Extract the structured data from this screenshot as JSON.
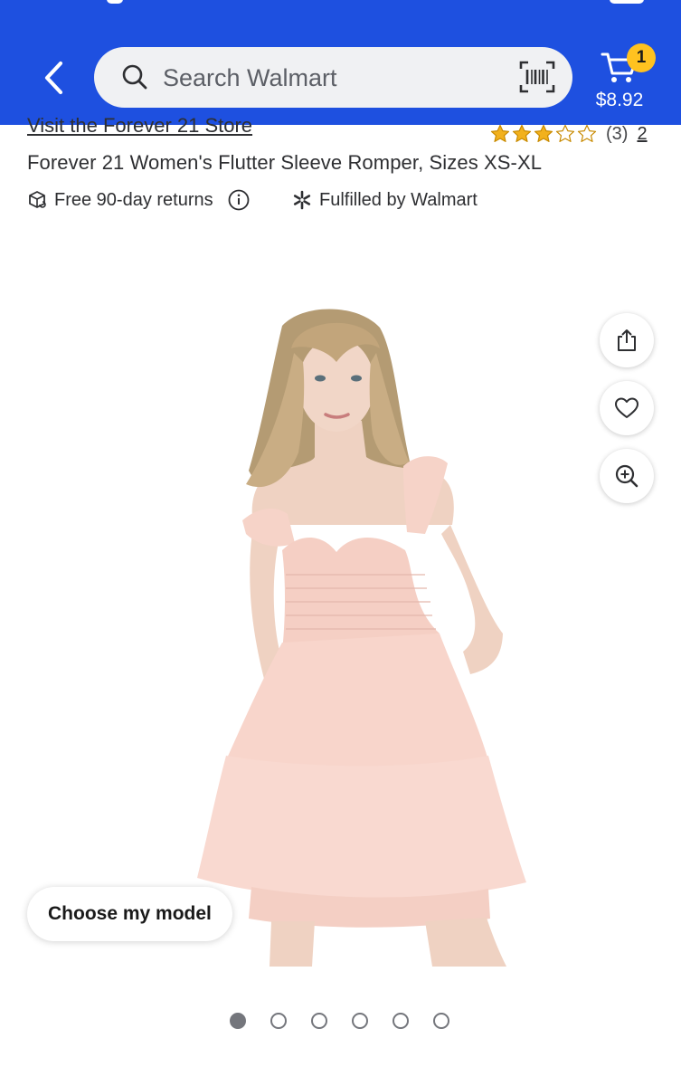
{
  "header": {
    "search": {
      "placeholder": "Search Walmart"
    },
    "cart": {
      "count": "1",
      "total": "$8.92"
    }
  },
  "product": {
    "store_link": "Visit the Forever 21 Store",
    "rating": {
      "stars": 3,
      "max": 5,
      "count_text": "(3)",
      "reviews_link": "2"
    },
    "title": "Forever 21 Women's Flutter Sleeve Romper, Sizes XS-XL",
    "features": [
      {
        "label": "Free 90-day returns",
        "icon": "returns-box-icon"
      },
      {
        "label": "Fulfilled by Walmart",
        "icon": "walmart-spark-icon"
      }
    ]
  },
  "gallery": {
    "choose_model_label": "Choose my model",
    "image_count": 6,
    "active_index": 0
  },
  "colors": {
    "brand_blue": "#1e50e0",
    "cart_badge": "#ffc220",
    "star": "#f2b11d"
  }
}
